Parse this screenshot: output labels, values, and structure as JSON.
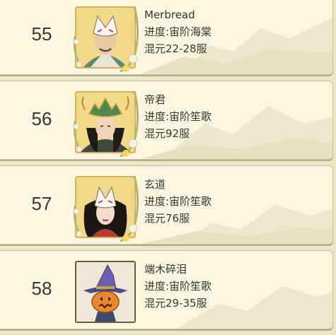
{
  "rows": [
    {
      "rank": "55",
      "name": "Merbread",
      "progress": "进度:宙阶海棠",
      "server": "混元22-28服",
      "portrait": "fox-mask-warrior",
      "frame": "flower-vine"
    },
    {
      "rank": "56",
      "name": "帝君",
      "progress": "进度:宙阶笙歌",
      "server": "混元92服",
      "portrait": "crowned-emperor",
      "frame": "flower-vine"
    },
    {
      "rank": "57",
      "name": "玄道",
      "progress": "进度:宙阶笙歌",
      "server": "混元76服",
      "portrait": "fox-mask-woman",
      "frame": "flower-vine"
    },
    {
      "rank": "58",
      "name": "端木碎泪",
      "progress": "进度:宙阶笙歌",
      "server": "混元29-35服",
      "portrait": "pumpkin-witch",
      "frame": "plain"
    }
  ],
  "colors": {
    "row_bg": "#fbf6df",
    "text": "#3b3629",
    "gold_frame": "#d8b25a",
    "mountain": "#e7e3c6"
  }
}
